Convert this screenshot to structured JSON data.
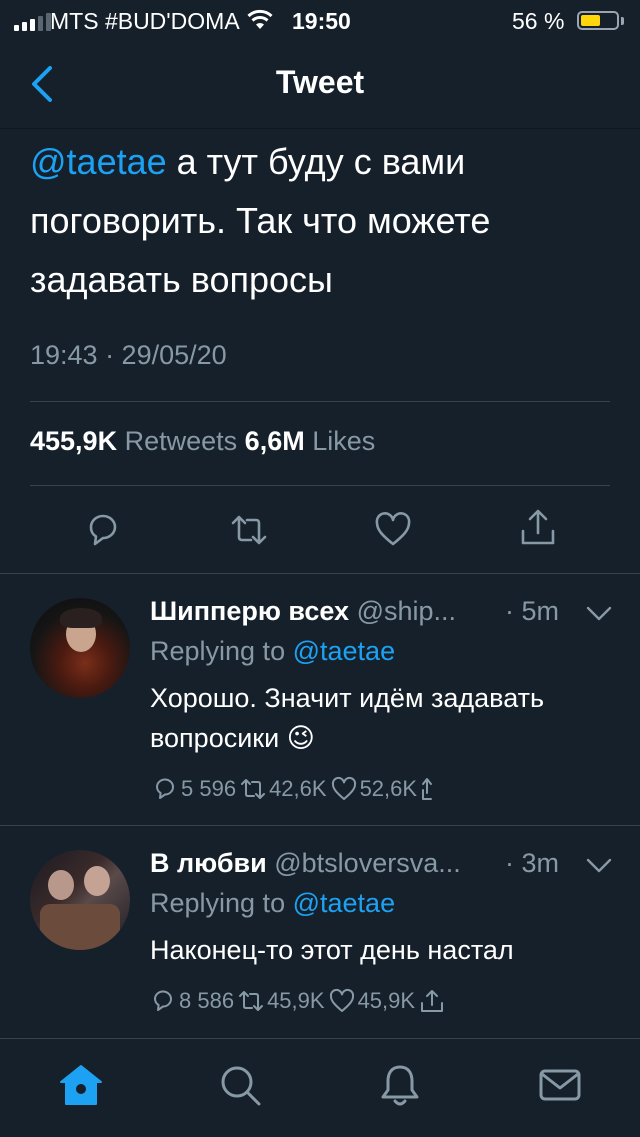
{
  "status_bar": {
    "carrier": "MTS #BUD'DOMA",
    "time": "19:50",
    "battery_percent": "56 %",
    "battery_level": 0.56
  },
  "nav": {
    "title": "Tweet",
    "back_icon": "chevron-left-icon"
  },
  "tweet": {
    "mention": "@taetae",
    "text": " а тут буду с вами поговорить. Так что можете задавать вопросы",
    "timestamp": "19:43 · 29/05/20",
    "retweets_count": "455,9K",
    "retweets_label": "Retweets",
    "likes_count": "6,6M",
    "likes_label": "Likes",
    "actions": [
      "reply-icon",
      "retweet-icon",
      "like-icon",
      "share-icon"
    ]
  },
  "replies": [
    {
      "name": "Шипперю всех",
      "handle": "@ship...",
      "time": "· 5m",
      "replying_label": "Replying to",
      "replying_to": "@taetae",
      "text": "Хорошо. Значит идём задавать вопросики 😉",
      "reply_count": "5 596",
      "retweet_count": "42,6K",
      "like_count": "52,6K"
    },
    {
      "name": "В любви",
      "handle": "@btsloversva...",
      "time": "· 3m",
      "replying_label": "Replying to",
      "replying_to": "@taetae",
      "text": "Наконец-то этот день настал",
      "reply_count": "8 586",
      "retweet_count": "45,9K",
      "like_count": "45,9K"
    }
  ],
  "tab_bar": [
    "home-icon",
    "search-icon",
    "notifications-icon",
    "messages-icon"
  ],
  "colors": {
    "background": "#15202b",
    "accent": "#1da1f2",
    "muted": "#8899a6",
    "divider": "#38444d"
  }
}
